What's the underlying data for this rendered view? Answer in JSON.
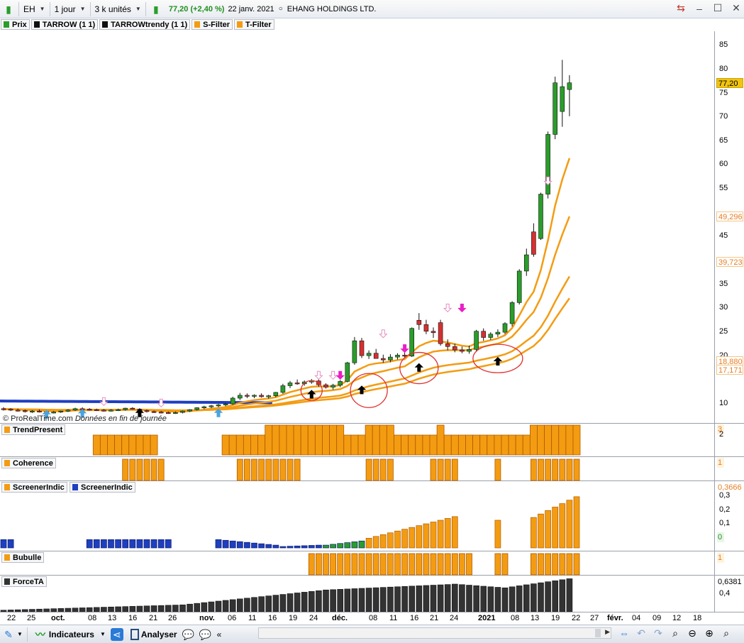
{
  "toolbar": {
    "symbol": "EH",
    "timeframe": "1 jour",
    "units": "3 k unités",
    "price": "77,20",
    "change": "(+2,40 %)",
    "date": "22 janv. 2021",
    "company": "EHANG HOLDINGS LTD."
  },
  "legend": [
    {
      "label": "Prix",
      "color": "#2a9d2a"
    },
    {
      "label": "TARROW (1 1)",
      "color": "#111111"
    },
    {
      "label": "TARROWtrendy (1 1)",
      "color": "#111111"
    },
    {
      "label": "S-Filter",
      "color": "#f39c12"
    },
    {
      "label": "T-Filter",
      "color": "#f39c12"
    }
  ],
  "watermark": {
    "brand": "© ProRealTime.com",
    "note": "Données en fin de journée"
  },
  "y_axis_ticks": [
    "85",
    "80",
    "75",
    "70",
    "65",
    "60",
    "55",
    "45",
    "35",
    "30",
    "25",
    "20",
    "10"
  ],
  "price_tags": [
    {
      "text": "77,20",
      "value": 77.2,
      "bg": "#f1c40f",
      "fg": "#000000"
    },
    {
      "text": "49,296",
      "value": 49.3,
      "bg": "#ffffff",
      "fg": "#e67e22"
    },
    {
      "text": "39,723",
      "value": 39.7,
      "bg": "#ffffff",
      "fg": "#e67e22"
    },
    {
      "text": "18,880",
      "value": 18.9,
      "bg": "#ffffff",
      "fg": "#e67e22"
    },
    {
      "text": "17,171",
      "value": 17.2,
      "bg": "#ffffff",
      "fg": "#e67e22"
    }
  ],
  "indicators": [
    {
      "name": "TrendPresent",
      "color": "#f39c12",
      "value": "3",
      "tick": "2"
    },
    {
      "name": "Coherence",
      "color": "#f39c12",
      "value": "1"
    },
    {
      "name": "ScreenerIndic",
      "name2": "ScreenerIndic",
      "color": "#f39c12",
      "color2": "#1f3fbf",
      "value": "0,3666",
      "ticks": [
        "0,3",
        "0,2",
        "0,1",
        "0"
      ]
    },
    {
      "name": "Bubulle",
      "color": "#f39c12",
      "value": "1"
    },
    {
      "name": "ForceTA",
      "color": "#333333",
      "value": "0,6381",
      "tick": "0,4"
    }
  ],
  "x_axis": [
    {
      "label": "22",
      "bold": false
    },
    {
      "label": "25",
      "bold": false
    },
    {
      "label": "oct.",
      "bold": true
    },
    {
      "label": "08",
      "bold": false
    },
    {
      "label": "13",
      "bold": false
    },
    {
      "label": "16",
      "bold": false
    },
    {
      "label": "21",
      "bold": false
    },
    {
      "label": "26",
      "bold": false
    },
    {
      "label": "nov.",
      "bold": true
    },
    {
      "label": "06",
      "bold": false
    },
    {
      "label": "11",
      "bold": false
    },
    {
      "label": "16",
      "bold": false
    },
    {
      "label": "19",
      "bold": false
    },
    {
      "label": "24",
      "bold": false
    },
    {
      "label": "déc.",
      "bold": true
    },
    {
      "label": "08",
      "bold": false
    },
    {
      "label": "11",
      "bold": false
    },
    {
      "label": "16",
      "bold": false
    },
    {
      "label": "21",
      "bold": false
    },
    {
      "label": "24",
      "bold": false
    },
    {
      "label": "2021",
      "bold": true
    },
    {
      "label": "08",
      "bold": false
    },
    {
      "label": "13",
      "bold": false
    },
    {
      "label": "19",
      "bold": false
    },
    {
      "label": "22",
      "bold": false
    },
    {
      "label": "27",
      "bold": false
    },
    {
      "label": "févr.",
      "bold": true
    },
    {
      "label": "04",
      "bold": false
    },
    {
      "label": "09",
      "bold": false
    },
    {
      "label": "12",
      "bold": false
    },
    {
      "label": "18",
      "bold": false
    }
  ],
  "bottombar": {
    "indicators_label": "Indicateurs",
    "analyse_label": "Analyser"
  },
  "chart_data": {
    "type": "candlestick",
    "candles": [
      [
        9,
        9.3,
        8.6,
        8.9
      ],
      [
        8.9,
        9.1,
        8.5,
        8.7
      ],
      [
        8.7,
        9,
        8.4,
        8.6
      ],
      [
        8.6,
        8.8,
        8.2,
        8.4
      ],
      [
        8.4,
        8.7,
        8.1,
        8.5
      ],
      [
        8.5,
        8.8,
        8.2,
        8.4
      ],
      [
        8.4,
        8.6,
        8,
        8.2
      ],
      [
        8.2,
        8.5,
        8,
        8.3
      ],
      [
        8.3,
        8.6,
        8.1,
        8.5
      ],
      [
        8.5,
        8.9,
        8.3,
        8.7
      ],
      [
        8.7,
        9.2,
        8.5,
        9
      ],
      [
        9,
        9.3,
        8.7,
        8.9
      ],
      [
        8.9,
        9.1,
        8.6,
        8.8
      ],
      [
        8.8,
        9,
        8.5,
        8.7
      ],
      [
        8.7,
        8.9,
        8.4,
        8.6
      ],
      [
        8.6,
        8.9,
        8.4,
        8.7
      ],
      [
        8.7,
        9,
        8.5,
        8.8
      ],
      [
        8.8,
        9.2,
        8.6,
        9.1
      ],
      [
        9.1,
        9.3,
        8.8,
        8.9
      ],
      [
        8.9,
        9.1,
        8.5,
        8.6
      ],
      [
        8.6,
        8.8,
        8.2,
        8.4
      ],
      [
        8.4,
        8.6,
        8.1,
        8.3
      ],
      [
        8.3,
        8.5,
        8,
        8.2
      ],
      [
        8.2,
        8.4,
        7.9,
        8.1
      ],
      [
        8.1,
        8.4,
        7.9,
        8.2
      ],
      [
        8.2,
        8.6,
        8,
        8.5
      ],
      [
        8.5,
        8.9,
        8.3,
        8.8
      ],
      [
        8.8,
        9.3,
        8.6,
        9.2
      ],
      [
        9.2,
        9.6,
        8.9,
        9.4
      ],
      [
        9.4,
        9.8,
        9.1,
        9.6
      ],
      [
        9.6,
        10,
        9.3,
        9.8
      ],
      [
        9.8,
        10.2,
        9.5,
        10
      ],
      [
        10,
        11.5,
        9.8,
        11.2
      ],
      [
        11.2,
        12.3,
        10.8,
        11.8
      ],
      [
        11.8,
        12.2,
        11.2,
        11.6
      ],
      [
        11.6,
        12,
        11.2,
        11.8
      ],
      [
        11.8,
        12.2,
        11.3,
        11.5
      ],
      [
        11.5,
        11.9,
        11.1,
        11.7
      ],
      [
        11.7,
        12.5,
        11.4,
        12.4
      ],
      [
        12.4,
        14.2,
        12.1,
        13.8
      ],
      [
        13.8,
        14.8,
        13.3,
        14.4
      ],
      [
        14.4,
        15.1,
        14,
        14.2
      ],
      [
        14.2,
        14.9,
        13.8,
        14.6
      ],
      [
        14.6,
        15.2,
        14.2,
        14.8
      ],
      [
        14.8,
        15.1,
        13.6,
        14
      ],
      [
        14,
        14.3,
        13.2,
        13.5
      ],
      [
        13.5,
        14.2,
        13,
        13.9
      ],
      [
        13.9,
        15,
        13.5,
        14.7
      ],
      [
        14.7,
        18.8,
        14.5,
        18.6
      ],
      [
        18.6,
        24,
        18.2,
        23.2
      ],
      [
        23.2,
        23.8,
        19.6,
        20.1
      ],
      [
        20.1,
        21.2,
        19.4,
        20.6
      ],
      [
        20.6,
        21.5,
        19.8,
        19.5
      ],
      [
        19.5,
        20.3,
        18.6,
        19.2
      ],
      [
        19.2,
        20.4,
        18.7,
        19.8
      ],
      [
        19.8,
        20.6,
        19.3,
        20.2
      ],
      [
        20.2,
        20.9,
        19.7,
        20
      ],
      [
        20,
        26,
        19.8,
        25.8
      ],
      [
        27.5,
        29,
        25.5,
        26.6
      ],
      [
        26.6,
        27.6,
        24.6,
        25.2
      ],
      [
        25.2,
        26,
        23.8,
        24.9
      ],
      [
        27,
        27.6,
        22.2,
        22.6
      ],
      [
        22.6,
        23.5,
        21.2,
        22
      ],
      [
        22,
        22.6,
        20.8,
        21.3
      ],
      [
        21.3,
        22,
        20.6,
        21
      ],
      [
        21,
        22.2,
        20.5,
        21.4
      ],
      [
        21.4,
        25.5,
        21,
        25.2
      ],
      [
        25.2,
        25.8,
        23.2,
        23.9
      ],
      [
        23.9,
        25,
        23.4,
        24.6
      ],
      [
        24.6,
        25.6,
        24,
        25
      ],
      [
        25,
        27.1,
        24.6,
        26.8
      ],
      [
        26.8,
        31.5,
        26.2,
        31.2
      ],
      [
        31.2,
        38.2,
        30.8,
        37.8
      ],
      [
        37.8,
        42.5,
        36.8,
        41.2
      ],
      [
        46,
        47.8,
        40.8,
        41.3
      ],
      [
        44.6,
        54.2,
        44.3,
        53.9
      ],
      [
        53.9,
        67,
        53,
        66.4
      ],
      [
        66.4,
        78.5,
        65.4,
        77.2
      ],
      [
        71.2,
        82,
        68,
        76.4
      ],
      [
        75.8,
        78.8,
        70.2,
        77.2
      ]
    ],
    "blue_band_start": 10.2,
    "blue_band_end": 8.4,
    "s_filter_values": [
      25.2,
      49.3
    ],
    "t_filter_values": [
      17.2,
      39.7
    ],
    "ylim": [
      6,
      88
    ]
  }
}
